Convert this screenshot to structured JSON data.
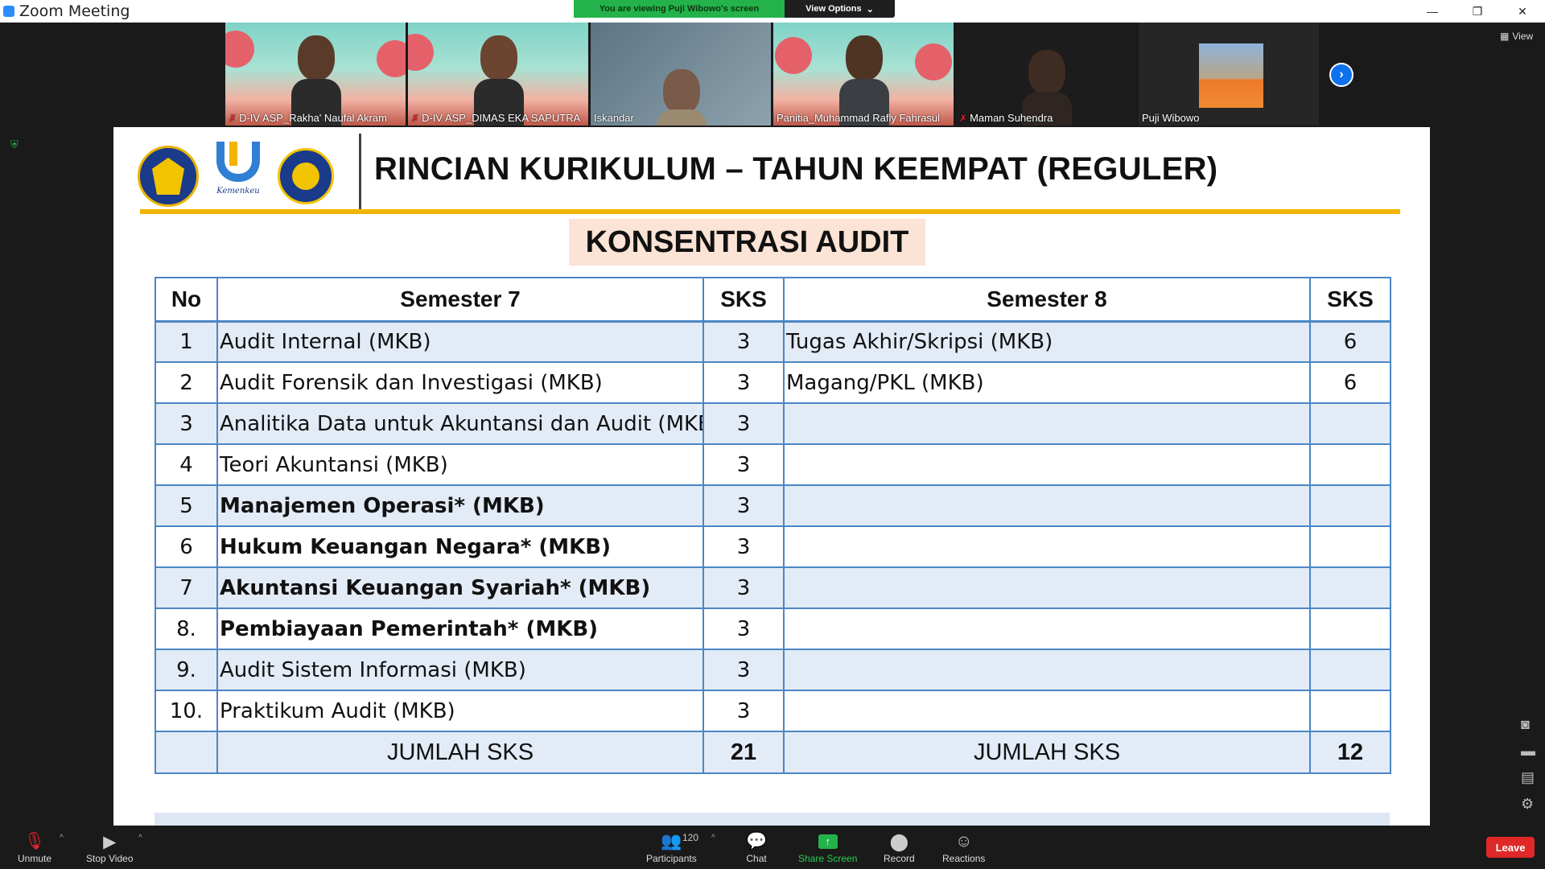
{
  "window": {
    "title": "Zoom Meeting",
    "controls": [
      "—",
      "❐",
      "✕"
    ]
  },
  "banner": {
    "viewing": "You are viewing Puji Wibowo's screen",
    "view_options": "View Options",
    "caret": "⌄"
  },
  "participants": [
    {
      "name": "D-IV ASP_Rakha' Naufal Akram",
      "muted": true
    },
    {
      "name": "D-IV ASP_DIMAS EKA SAPUTRA",
      "muted": true
    },
    {
      "name": "Iskandar",
      "muted": false
    },
    {
      "name": "Panitia_Muhammad Rafly Fahrasul",
      "muted": false
    },
    {
      "name": "Maman Suhendra",
      "muted": true
    },
    {
      "name": "Puji Wibowo",
      "muted": false
    }
  ],
  "gallery": {
    "view_label": "View",
    "next_icon": "›"
  },
  "slide": {
    "title": "RINCIAN KURIKULUM – TAHUN KEEMPAT (REGULER)",
    "subtitle": "KONSENTRASI AUDIT",
    "logo_text": "Kemenkeu",
    "headers": {
      "no": "No",
      "sem7": "Semester 7",
      "sks7": "SKS",
      "sem8": "Semester 8",
      "sks8": "SKS"
    },
    "rows": [
      {
        "no": "1",
        "course7": "Audit Internal (MKB)",
        "sks7": "3",
        "course8": "Tugas Akhir/Skripsi (MKB)",
        "sks8": "6"
      },
      {
        "no": "2",
        "course7": "Audit Forensik dan Investigasi (MKB)",
        "sks7": "3",
        "course8": "Magang/PKL (MKB)",
        "sks8": "6"
      },
      {
        "no": "3",
        "course7": "Analitika Data untuk Akuntansi dan Audit (MKB)",
        "sks7": "3",
        "course8": "",
        "sks8": ""
      },
      {
        "no": "4",
        "course7": "Teori Akuntansi (MKB)",
        "sks7": "3",
        "course8": "",
        "sks8": ""
      },
      {
        "no": "5",
        "course7": "Manajemen Operasi* (MKB)",
        "sks7": "3",
        "course8": "",
        "sks8": ""
      },
      {
        "no": "6",
        "course7": "Hukum Keuangan Negara* (MKB)",
        "sks7": "3",
        "course8": "",
        "sks8": ""
      },
      {
        "no": "7",
        "course7": "Akuntansi Keuangan Syariah* (MKB)",
        "sks7": "3",
        "course8": "",
        "sks8": ""
      },
      {
        "no": "8.",
        "course7": "Pembiayaan Pemerintah* (MKB)",
        "sks7": "3",
        "course8": "",
        "sks8": ""
      },
      {
        "no": "9.",
        "course7": "Audit Sistem Informasi (MKB)",
        "sks7": "3",
        "course8": "",
        "sks8": ""
      },
      {
        "no": "10.",
        "course7": "Praktikum Audit (MKB)",
        "sks7": "3",
        "course8": "",
        "sks8": ""
      }
    ],
    "total": {
      "label7": "JUMLAH SKS",
      "sks7": "21",
      "label8": "JUMLAH SKS",
      "sks8": "12"
    }
  },
  "toolbar": {
    "unmute": "Unmute",
    "stop_video": "Stop Video",
    "participants": "Participants",
    "participant_count": "120",
    "chat": "Chat",
    "share_screen": "Share Screen",
    "record": "Record",
    "reactions": "Reactions",
    "leave": "Leave",
    "caret": "^"
  }
}
